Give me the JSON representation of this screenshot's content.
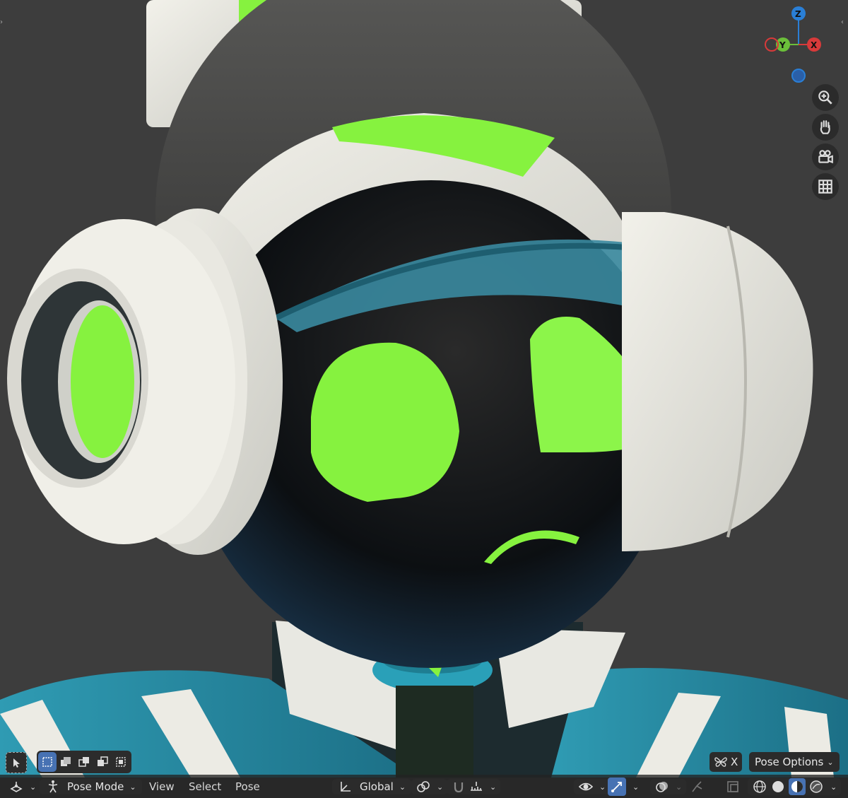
{
  "viewport": {
    "scene": "3d robot character head in Blender viewport",
    "background_color": "#3d3d3d",
    "accent_green": "#86f23f",
    "teal": "#2a8fa6"
  },
  "gizmo": {
    "z_label": "Z",
    "y_label": "Y",
    "x_label": "X"
  },
  "nav_buttons": [
    "zoom-icon",
    "pan-hand-icon",
    "camera-icon",
    "grid-icon"
  ],
  "bottom_left_tools": [
    "select-cursor-icon"
  ],
  "select_modes": [
    "select-new-icon",
    "select-extend-icon",
    "select-subtract-icon",
    "select-invert-icon",
    "select-intersect-icon"
  ],
  "header": {
    "mode_label": "Pose Mode",
    "menu": {
      "view": "View",
      "select": "Select",
      "pose": "Pose"
    },
    "transform_orientation": "Global",
    "pose_options_label": "Pose Options",
    "x_mirror_label": "X"
  }
}
